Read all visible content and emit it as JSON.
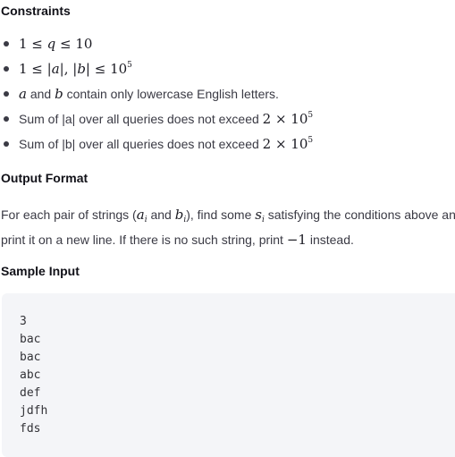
{
  "constraints": {
    "heading": "Constraints",
    "items": [
      {
        "math": [
          "1 ≤ ",
          "q",
          " ≤ 10"
        ]
      },
      {
        "math": [
          "1 ≤ |",
          "a",
          "|, |",
          "b",
          "| ≤ 10",
          "5"
        ]
      },
      {
        "a": "a",
        "text1": " and ",
        "b": "b",
        "text2": " contain only lowercase English letters."
      },
      {
        "text": "Sum of |a| over all queries does not exceed ",
        "math": "2 × 10",
        "sup": "5"
      },
      {
        "text": "Sum of |b| over all queries does not exceed ",
        "math": "2 × 10",
        "sup": "5"
      }
    ]
  },
  "output_format": {
    "heading": "Output Format",
    "line1": {
      "t1": "For each pair of strings (",
      "a": "a",
      "ai": "i",
      "t2": " and ",
      "b": "b",
      "bi": "i",
      "t3": "), find some ",
      "s": "s",
      "si": "i",
      "t4": " satisfying the conditions above and"
    },
    "line2": {
      "t1": "print it on a new line. If there is no such string, print ",
      "m": "−1",
      "t2": " instead."
    }
  },
  "sample_input": {
    "heading": "Sample Input",
    "code": "3\nbac\nbac\nabc\ndef\njdfh\nfds"
  }
}
